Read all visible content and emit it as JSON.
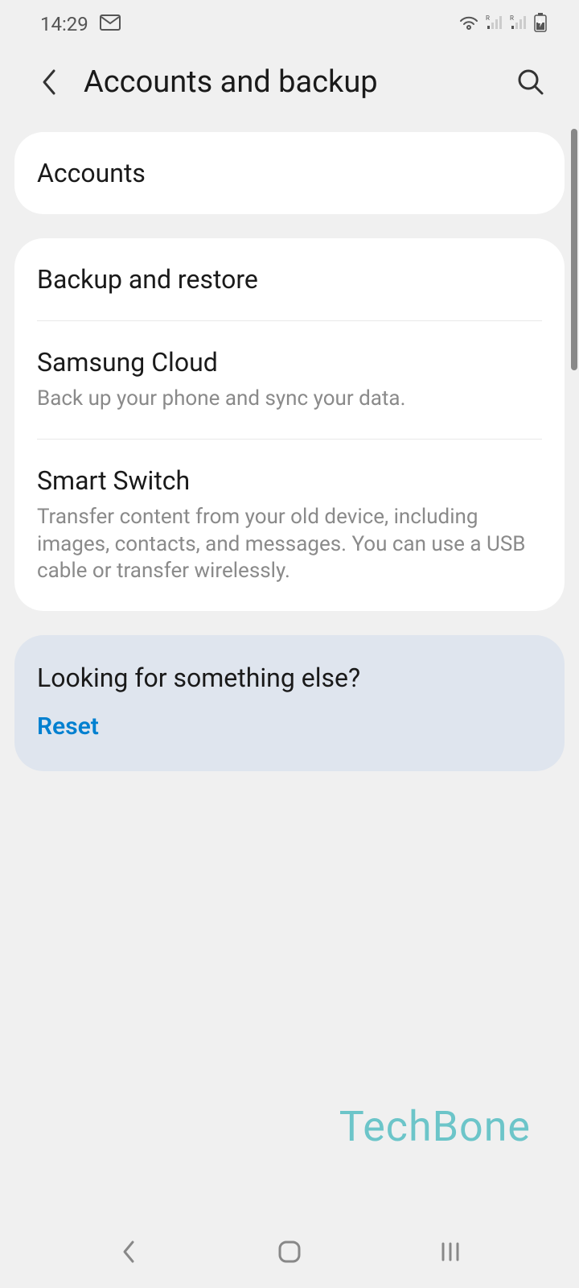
{
  "status_bar": {
    "time": "14:29"
  },
  "header": {
    "title": "Accounts and backup"
  },
  "card1": {
    "item1": {
      "title": "Accounts"
    }
  },
  "card2": {
    "item1": {
      "title": "Backup and restore"
    },
    "item2": {
      "title": "Samsung Cloud",
      "subtitle": "Back up your phone and sync your data."
    },
    "item3": {
      "title": "Smart Switch",
      "subtitle": "Transfer content from your old device, including images, contacts, and messages. You can use a USB cable or transfer wirelessly."
    }
  },
  "suggestion": {
    "title": "Looking for something else?",
    "link": "Reset"
  },
  "watermark": "TechBone"
}
